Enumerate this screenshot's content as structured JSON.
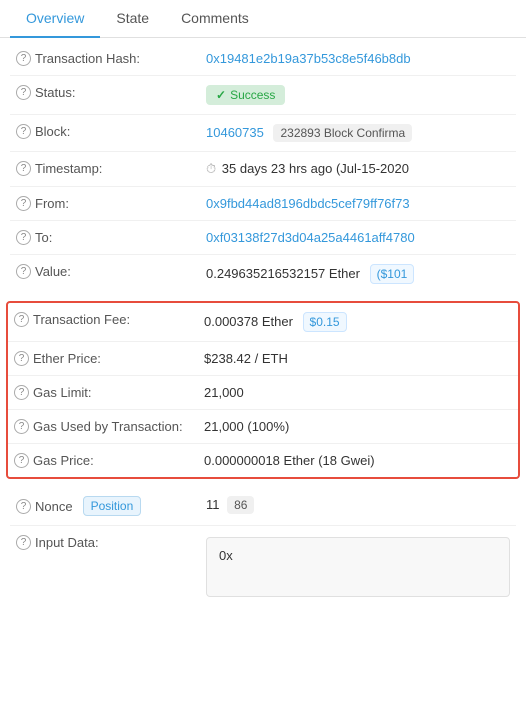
{
  "tabs": [
    {
      "label": "Overview",
      "active": true
    },
    {
      "label": "State",
      "active": false
    },
    {
      "label": "Comments",
      "active": false
    }
  ],
  "rows": {
    "transaction_hash_label": "Transaction Hash:",
    "transaction_hash_value": "0x19481e2b19a37b53c8e5f46b8db",
    "status_label": "Status:",
    "status_value": "Success",
    "block_label": "Block:",
    "block_value": "10460735",
    "block_confirmations": "232893 Block Confirma",
    "timestamp_label": "Timestamp:",
    "timestamp_value": "35 days 23 hrs ago (Jul-15-2020",
    "from_label": "From:",
    "from_value": "0x9fbd44ad8196dbdc5cef79ff76f73",
    "to_label": "To:",
    "to_value": "0xf03138f27d3d04a25a4461aff4780",
    "value_label": "Value:",
    "value_eth": "0.249635216532157 Ether",
    "value_usd": "($101",
    "tx_fee_label": "Transaction Fee:",
    "tx_fee_eth": "0.000378 Ether",
    "tx_fee_usd": "$0.15",
    "ether_price_label": "Ether Price:",
    "ether_price_value": "$238.42 / ETH",
    "gas_limit_label": "Gas Limit:",
    "gas_limit_value": "21,000",
    "gas_used_label": "Gas Used by Transaction:",
    "gas_used_value": "21,000 (100%)",
    "gas_price_label": "Gas Price:",
    "gas_price_value": "0.000000018 Ether (18 Gwei)",
    "nonce_label": "Nonce",
    "nonce_badge": "Position",
    "nonce_value": "11",
    "nonce_position": "86",
    "input_data_label": "Input Data:",
    "input_data_value": "0x"
  }
}
